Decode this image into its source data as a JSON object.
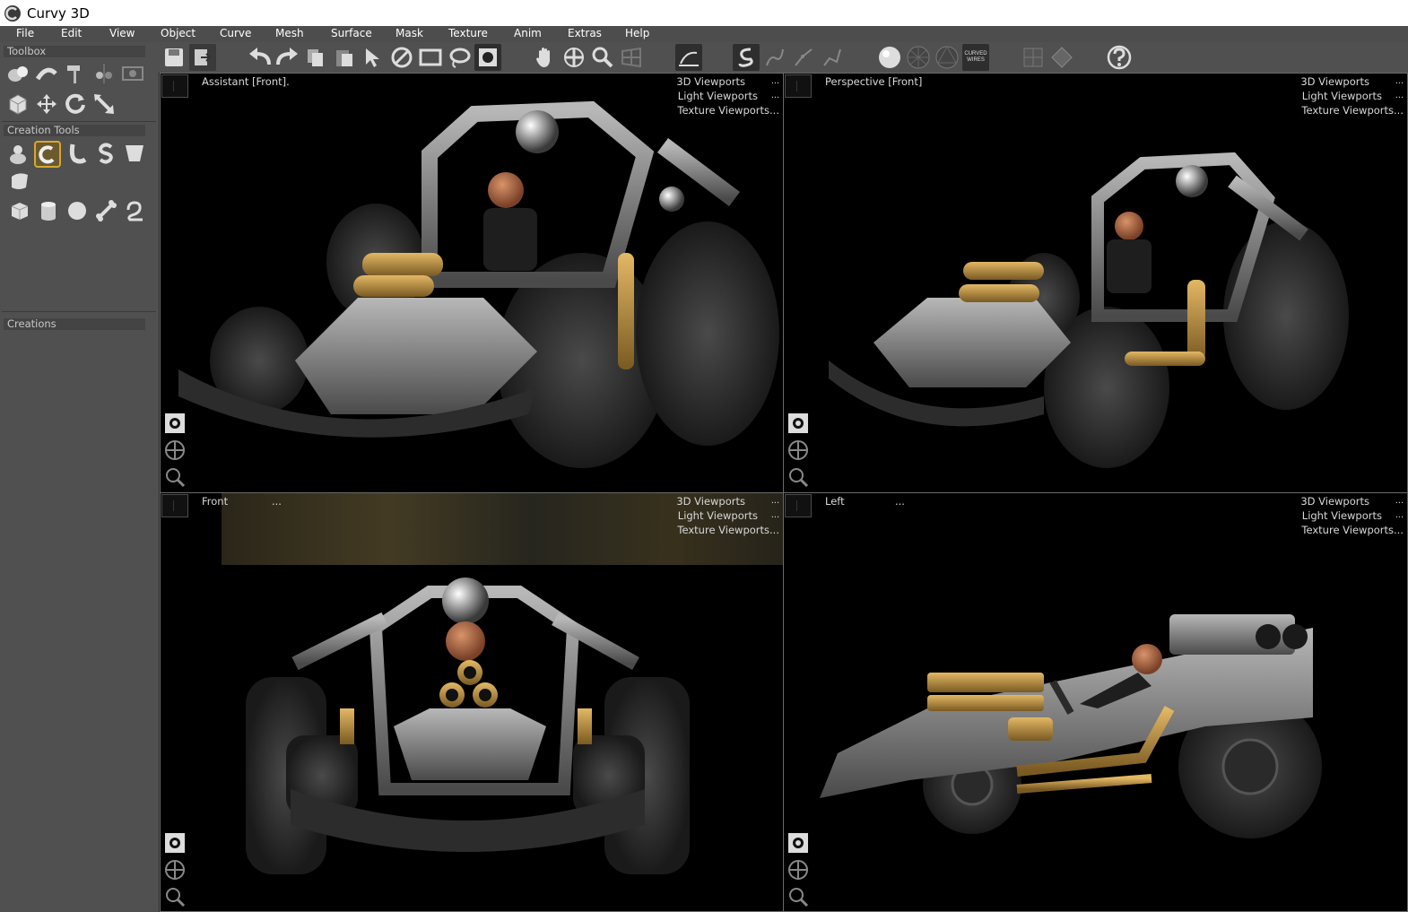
{
  "window": {
    "title": "Curvy 3D"
  },
  "menu": [
    "File",
    "Edit",
    "View",
    "Object",
    "Curve",
    "Mesh",
    "Surface",
    "Mask",
    "Texture",
    "Anim",
    "Extras",
    "Help"
  ],
  "left_panel": {
    "toolbox_header": "Toolbox",
    "creation_tools_header": "Creation Tools",
    "creations_header": "Creations"
  },
  "toolbar": {
    "curved_wires_label": "CURVED WIRES"
  },
  "viewports": [
    {
      "label": "Assistant [Front].",
      "menu": [
        "3D Viewports",
        "Light Viewports",
        "Texture Viewports..."
      ],
      "dots": [
        "...",
        "..."
      ]
    },
    {
      "label": "Perspective [Front]",
      "menu": [
        "3D Viewports",
        "Light Viewports",
        "Texture Viewports..."
      ],
      "dots": [
        "...",
        "..."
      ]
    },
    {
      "label": "Front",
      "extra": "...",
      "menu": [
        "3D Viewports",
        "Light Viewports",
        "Texture Viewports..."
      ],
      "dots": [
        "...",
        "..."
      ]
    },
    {
      "label": "Left",
      "extra": "...",
      "menu": [
        "3D Viewports",
        "Light Viewports",
        "Texture Viewports..."
      ],
      "dots": [
        "...",
        "..."
      ]
    }
  ],
  "colors": {
    "background": "#3c3c3c",
    "panel": "#505050",
    "viewport": "#000000",
    "active_tool_border": "#d9a632",
    "chrome": "#9a9a9a",
    "brass": "#b8893a"
  }
}
